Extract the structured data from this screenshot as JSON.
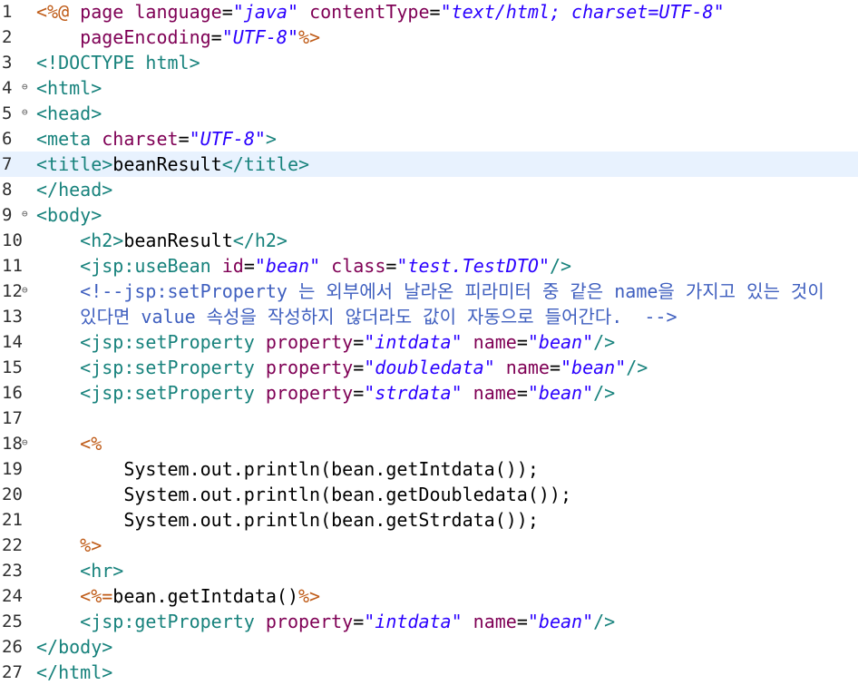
{
  "editor": {
    "lines": [
      {
        "num": "1",
        "fold": false,
        "segments": [
          {
            "c": "d",
            "t": "<%@"
          },
          {
            "c": "p",
            "t": " "
          },
          {
            "c": "a",
            "t": "page"
          },
          {
            "c": "p",
            "t": " "
          },
          {
            "c": "a",
            "t": "language"
          },
          {
            "c": "p",
            "t": "="
          },
          {
            "c": "v",
            "t": "\"java\""
          },
          {
            "c": "p",
            "t": " "
          },
          {
            "c": "a",
            "t": "contentType"
          },
          {
            "c": "p",
            "t": "="
          },
          {
            "c": "v",
            "t": "\"text/html; charset=UTF-8\""
          }
        ]
      },
      {
        "num": "2",
        "fold": false,
        "segments": [
          {
            "c": "p",
            "t": "    "
          },
          {
            "c": "a",
            "t": "pageEncoding"
          },
          {
            "c": "p",
            "t": "="
          },
          {
            "c": "v",
            "t": "\"UTF-8\""
          },
          {
            "c": "d",
            "t": "%>"
          }
        ]
      },
      {
        "num": "3",
        "fold": false,
        "segments": [
          {
            "c": "t",
            "t": "<!DOCTYPE html>"
          }
        ]
      },
      {
        "num": "4",
        "fold": true,
        "segments": [
          {
            "c": "t",
            "t": "<html>"
          }
        ]
      },
      {
        "num": "5",
        "fold": true,
        "segments": [
          {
            "c": "t",
            "t": "<head>"
          }
        ]
      },
      {
        "num": "6",
        "fold": false,
        "segments": [
          {
            "c": "t",
            "t": "<meta"
          },
          {
            "c": "p",
            "t": " "
          },
          {
            "c": "a",
            "t": "charset"
          },
          {
            "c": "p",
            "t": "="
          },
          {
            "c": "v",
            "t": "\"UTF-8\""
          },
          {
            "c": "t",
            "t": ">"
          }
        ]
      },
      {
        "num": "7",
        "fold": false,
        "current": true,
        "segments": [
          {
            "c": "t",
            "t": "<title>"
          },
          {
            "c": "p",
            "t": "beanResult"
          },
          {
            "c": "t",
            "t": "</title>"
          }
        ]
      },
      {
        "num": "8",
        "fold": false,
        "segments": [
          {
            "c": "t",
            "t": "</head>"
          }
        ]
      },
      {
        "num": "9",
        "fold": true,
        "segments": [
          {
            "c": "t",
            "t": "<body>"
          }
        ]
      },
      {
        "num": "10",
        "fold": false,
        "segments": [
          {
            "c": "p",
            "t": "    "
          },
          {
            "c": "t",
            "t": "<h2>"
          },
          {
            "c": "p",
            "t": "beanResult"
          },
          {
            "c": "t",
            "t": "</h2>"
          }
        ]
      },
      {
        "num": "11",
        "fold": false,
        "segments": [
          {
            "c": "p",
            "t": "    "
          },
          {
            "c": "t",
            "t": "<jsp:useBean"
          },
          {
            "c": "p",
            "t": " "
          },
          {
            "c": "a",
            "t": "id"
          },
          {
            "c": "p",
            "t": "="
          },
          {
            "c": "v",
            "t": "\"bean\""
          },
          {
            "c": "p",
            "t": " "
          },
          {
            "c": "a",
            "t": "class"
          },
          {
            "c": "p",
            "t": "="
          },
          {
            "c": "v",
            "t": "\"test.TestDTO\""
          },
          {
            "c": "t",
            "t": "/>"
          }
        ]
      },
      {
        "num": "12",
        "fold": true,
        "segments": [
          {
            "c": "p",
            "t": "    "
          },
          {
            "c": "c",
            "t": "<!--jsp:setProperty 는 외부에서 날라온 피라미터 중 같은 name을 가지고 있는 것이"
          }
        ]
      },
      {
        "num": "13",
        "fold": false,
        "segments": [
          {
            "c": "p",
            "t": "    "
          },
          {
            "c": "c",
            "t": "있다면 value 속성을 작성하지 않더라도 값이 자동으로 들어간다.  -->"
          }
        ]
      },
      {
        "num": "14",
        "fold": false,
        "segments": [
          {
            "c": "p",
            "t": "    "
          },
          {
            "c": "t",
            "t": "<jsp:setProperty"
          },
          {
            "c": "p",
            "t": " "
          },
          {
            "c": "a",
            "t": "property"
          },
          {
            "c": "p",
            "t": "="
          },
          {
            "c": "v",
            "t": "\"intdata\""
          },
          {
            "c": "p",
            "t": " "
          },
          {
            "c": "a",
            "t": "name"
          },
          {
            "c": "p",
            "t": "="
          },
          {
            "c": "v",
            "t": "\"bean\""
          },
          {
            "c": "t",
            "t": "/>"
          }
        ]
      },
      {
        "num": "15",
        "fold": false,
        "segments": [
          {
            "c": "p",
            "t": "    "
          },
          {
            "c": "t",
            "t": "<jsp:setProperty"
          },
          {
            "c": "p",
            "t": " "
          },
          {
            "c": "a",
            "t": "property"
          },
          {
            "c": "p",
            "t": "="
          },
          {
            "c": "v",
            "t": "\"doubledata\""
          },
          {
            "c": "p",
            "t": " "
          },
          {
            "c": "a",
            "t": "name"
          },
          {
            "c": "p",
            "t": "="
          },
          {
            "c": "v",
            "t": "\"bean\""
          },
          {
            "c": "t",
            "t": "/>"
          }
        ]
      },
      {
        "num": "16",
        "fold": false,
        "segments": [
          {
            "c": "p",
            "t": "    "
          },
          {
            "c": "t",
            "t": "<jsp:setProperty"
          },
          {
            "c": "p",
            "t": " "
          },
          {
            "c": "a",
            "t": "property"
          },
          {
            "c": "p",
            "t": "="
          },
          {
            "c": "v",
            "t": "\"strdata\""
          },
          {
            "c": "p",
            "t": " "
          },
          {
            "c": "a",
            "t": "name"
          },
          {
            "c": "p",
            "t": "="
          },
          {
            "c": "v",
            "t": "\"bean\""
          },
          {
            "c": "t",
            "t": "/>"
          }
        ]
      },
      {
        "num": "17",
        "fold": false,
        "segments": []
      },
      {
        "num": "18",
        "fold": true,
        "segments": [
          {
            "c": "p",
            "t": "    "
          },
          {
            "c": "d",
            "t": "<%"
          }
        ]
      },
      {
        "num": "19",
        "fold": false,
        "segments": [
          {
            "c": "p",
            "t": "        System.out.println(bean.getIntdata());"
          }
        ]
      },
      {
        "num": "20",
        "fold": false,
        "segments": [
          {
            "c": "p",
            "t": "        System.out.println(bean.getDoubledata());"
          }
        ]
      },
      {
        "num": "21",
        "fold": false,
        "segments": [
          {
            "c": "p",
            "t": "        System.out.println(bean.getStrdata());"
          }
        ]
      },
      {
        "num": "22",
        "fold": false,
        "segments": [
          {
            "c": "p",
            "t": "    "
          },
          {
            "c": "d",
            "t": "%>"
          }
        ]
      },
      {
        "num": "23",
        "fold": false,
        "segments": [
          {
            "c": "p",
            "t": "    "
          },
          {
            "c": "t",
            "t": "<hr>"
          }
        ]
      },
      {
        "num": "24",
        "fold": false,
        "segments": [
          {
            "c": "p",
            "t": "    "
          },
          {
            "c": "d",
            "t": "<%="
          },
          {
            "c": "p",
            "t": "bean.getIntdata()"
          },
          {
            "c": "d",
            "t": "%>"
          }
        ]
      },
      {
        "num": "25",
        "fold": false,
        "segments": [
          {
            "c": "p",
            "t": "    "
          },
          {
            "c": "t",
            "t": "<jsp:getProperty"
          },
          {
            "c": "p",
            "t": " "
          },
          {
            "c": "a",
            "t": "property"
          },
          {
            "c": "p",
            "t": "="
          },
          {
            "c": "v",
            "t": "\"intdata\""
          },
          {
            "c": "p",
            "t": " "
          },
          {
            "c": "a",
            "t": "name"
          },
          {
            "c": "p",
            "t": "="
          },
          {
            "c": "v",
            "t": "\"bean\""
          },
          {
            "c": "t",
            "t": "/>"
          }
        ]
      },
      {
        "num": "26",
        "fold": false,
        "segments": [
          {
            "c": "t",
            "t": "</body>"
          }
        ]
      },
      {
        "num": "27",
        "fold": false,
        "segments": [
          {
            "c": "t",
            "t": "</html>"
          }
        ]
      }
    ],
    "fold_icon": "collapse-minus-icon",
    "colors": {
      "tag": "#17827c",
      "attribute": "#7f0055",
      "value": "#2a00ff",
      "directive": "#bf5b17",
      "comment": "#3f5fbf",
      "current_line": "#e8f2fe"
    }
  }
}
